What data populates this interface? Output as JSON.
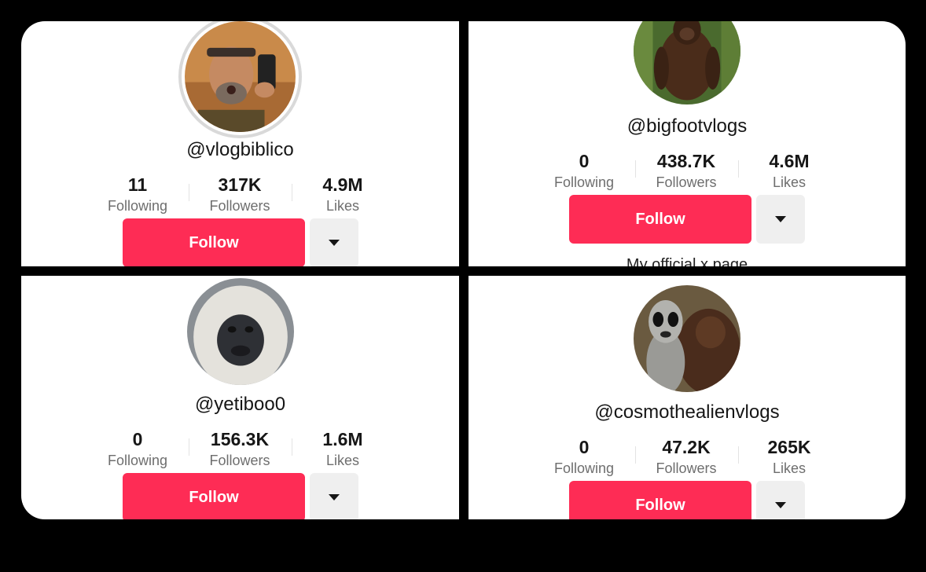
{
  "profiles": [
    {
      "avatar_icon": "man-selfie-avatar",
      "handle": "@vlogbiblico",
      "following": "11",
      "following_label": "Following",
      "followers": "317K",
      "followers_label": "Followers",
      "likes": "4.9M",
      "likes_label": "Likes",
      "follow_label": "Follow"
    },
    {
      "avatar_icon": "bigfoot-avatar",
      "handle": "@bigfootvlogs",
      "following": "0",
      "following_label": "Following",
      "followers": "438.7K",
      "followers_label": "Followers",
      "likes": "4.6M",
      "likes_label": "Likes",
      "follow_label": "Follow",
      "bio": "My official x page"
    },
    {
      "avatar_icon": "yeti-avatar",
      "handle": "@yetiboo0",
      "following": "0",
      "following_label": "Following",
      "followers": "156.3K",
      "followers_label": "Followers",
      "likes": "1.6M",
      "likes_label": "Likes",
      "follow_label": "Follow"
    },
    {
      "avatar_icon": "alien-and-bigfoot-avatar",
      "handle": "@cosmothealienvlogs",
      "following": "0",
      "following_label": "Following",
      "followers": "47.2K",
      "followers_label": "Followers",
      "likes": "265K",
      "likes_label": "Likes",
      "follow_label": "Follow"
    }
  ],
  "colors": {
    "follow_button": "#fe2c55",
    "more_button": "#efefef",
    "label_gray": "#6e6e6e"
  },
  "more_icon": "caret-down-icon"
}
